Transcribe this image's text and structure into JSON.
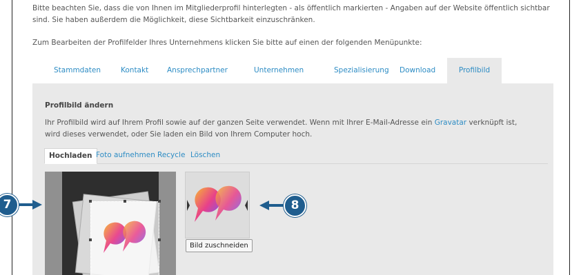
{
  "intro": {
    "paragraph1": "Bitte beachten Sie, dass die von Ihnen im Mitgliederprofil hinterlegten - als öffentlich markierten - Angaben auf der Website öffentlich sichtbar sind. Sie haben außerdem die Möglichkeit, diese Sichtbarkeit einzuschränken.",
    "paragraph2": "Zum Bearbeiten der Profilfelder Ihres Unternehmens klicken Sie bitte auf einen der folgenden Menüpunkte:"
  },
  "tabs": [
    {
      "label": "Stammdaten"
    },
    {
      "label": "Kontakt"
    },
    {
      "label": "Ansprechpartner"
    },
    {
      "label": "Unternehmen"
    },
    {
      "label": "Spezialisierung"
    },
    {
      "label": "Download"
    },
    {
      "label": "Profilbild",
      "active": true
    }
  ],
  "panel": {
    "title": "Profilbild ändern",
    "desc_before": "Ihr Profilbild wird auf Ihrem Profil sowie auf der ganzen Seite verwendet. Wenn mit Ihrer E-Mail-Adresse ein ",
    "desc_link": "Gravatar",
    "desc_after": " verknüpft ist, wird dieses verwendet, oder Sie laden ein Bild von Ihrem Computer hoch.",
    "subtabs": [
      {
        "label": "Hochladen",
        "active": true
      },
      {
        "label": "Foto aufnehmen"
      },
      {
        "label": "Recycle"
      },
      {
        "label": "Löschen"
      }
    ],
    "crop_button": "Bild zuschneiden"
  },
  "markers": {
    "left": "7",
    "right": "8"
  },
  "colors": {
    "link": "#2d8cc4",
    "marker": "#1f5d8e",
    "panel": "#e9e9e9"
  },
  "icons": {
    "logo": "speech-bubbles-logo-icon",
    "arrow": "arrow-icon"
  }
}
